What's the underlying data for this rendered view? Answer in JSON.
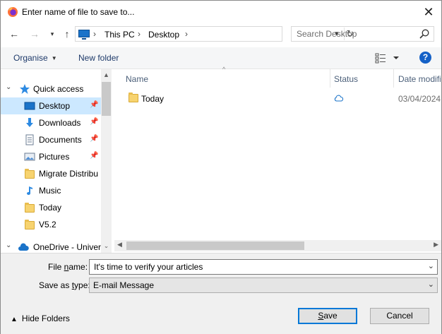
{
  "window": {
    "title": "Enter name of file to save to..."
  },
  "address": {
    "crumbs": [
      "This PC",
      "Desktop"
    ]
  },
  "search": {
    "placeholder": "Search Desktop"
  },
  "toolbar": {
    "organise": "Organise",
    "new_folder": "New folder",
    "help": "?"
  },
  "nav": {
    "items": [
      {
        "label": "Quick access"
      },
      {
        "label": "Desktop"
      },
      {
        "label": "Downloads"
      },
      {
        "label": "Documents"
      },
      {
        "label": "Pictures"
      },
      {
        "label": "Migrate Distribu"
      },
      {
        "label": "Music"
      },
      {
        "label": "Today"
      },
      {
        "label": "V5.2"
      },
      {
        "label": "OneDrive - Univer"
      }
    ]
  },
  "files": {
    "columns": {
      "name": "Name",
      "status": "Status",
      "date": "Date modifi"
    },
    "rows": [
      {
        "name": "Today",
        "date": "03/04/2024"
      }
    ]
  },
  "form": {
    "file_name_label_pre": "File ",
    "file_name_label_u": "n",
    "file_name_label_post": "ame:",
    "file_name_value": "It's time to verify your articles",
    "type_label_pre": "Save as ",
    "type_label_u": "t",
    "type_label_post": "ype:",
    "type_value": "E-mail Message"
  },
  "footer": {
    "hide_folders": "Hide Folders",
    "save_pre": "",
    "save_u": "S",
    "save_post": "ave",
    "cancel": "Cancel"
  }
}
